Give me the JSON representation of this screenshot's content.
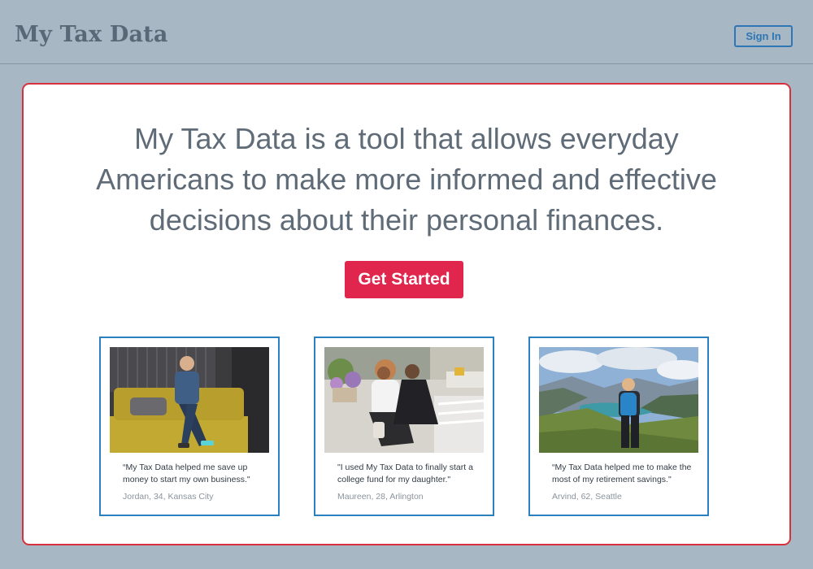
{
  "header": {
    "logo": "My Tax Data",
    "signin_label": "Sign In"
  },
  "hero": {
    "headline_lines": [
      "My Tax Data is a tool that allows everyday",
      "Americans to make more informed and effective",
      "decisions about their personal finances."
    ],
    "cta_label": "Get Started"
  },
  "testimonials": [
    {
      "quote": "“My Tax Data helped me save up money to start my own business.\"",
      "author": "Jordan, 34, Kansas City",
      "photo": "man-on-couch-photo"
    },
    {
      "quote": "\"I used My Tax Data to finally start a college fund for my daughter.\"",
      "author": "Maureen, 28, Arlington",
      "photo": "mother-daughter-photo"
    },
    {
      "quote": "“My Tax Data helped me to make the most of my retirement savings.\"",
      "author": "Arvind, 62, Seattle",
      "photo": "hiker-mountains-photo"
    }
  ],
  "colors": {
    "background": "#a7b7c3",
    "brand_text": "#596877",
    "accent_blue": "#2e76b4",
    "cta_red": "#e0264d",
    "panel_border": "#d8313d"
  }
}
